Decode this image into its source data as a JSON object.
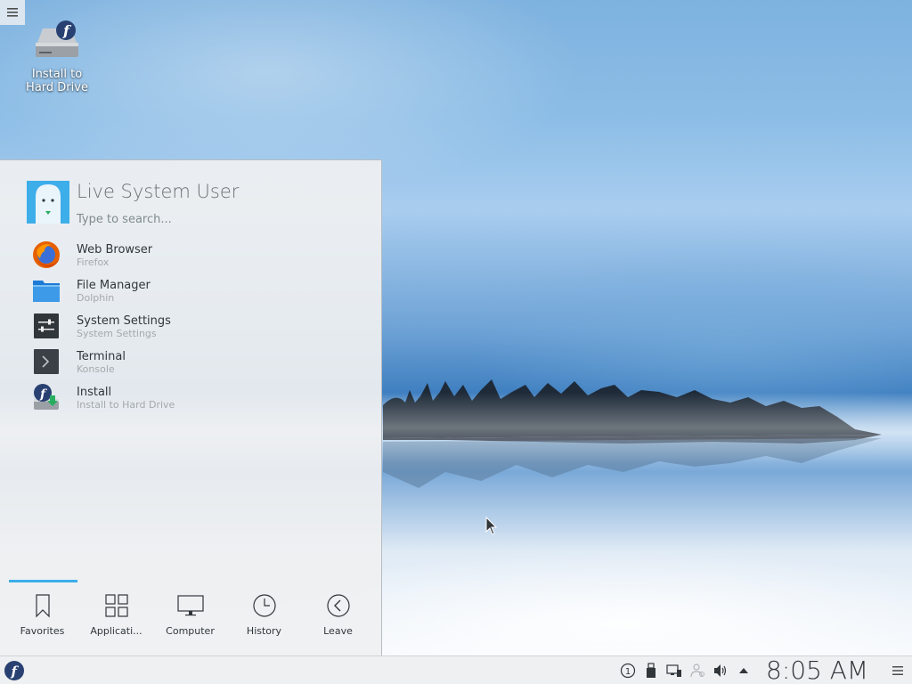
{
  "desktop": {
    "icons": [
      {
        "label": "Install to\nHard Drive",
        "icon": "fedora-install-drive-icon"
      }
    ],
    "toolbox_icon": "hamburger-menu-icon"
  },
  "launcher": {
    "user_name": "Live System User",
    "search_placeholder": "Type to search...",
    "favorites": [
      {
        "title": "Web Browser",
        "subtitle": "Firefox",
        "icon": "firefox-icon"
      },
      {
        "title": "File Manager",
        "subtitle": "Dolphin",
        "icon": "folder-icon"
      },
      {
        "title": "System Settings",
        "subtitle": "System Settings",
        "icon": "settings-icon"
      },
      {
        "title": "Terminal",
        "subtitle": "Konsole",
        "icon": "terminal-icon"
      },
      {
        "title": "Install",
        "subtitle": "Install to Hard Drive",
        "icon": "fedora-install-icon"
      }
    ],
    "tabs": [
      {
        "label": "Favorites",
        "icon": "bookmark-icon",
        "active": true
      },
      {
        "label": "Applicati...",
        "icon": "grid-icon",
        "active": false
      },
      {
        "label": "Computer",
        "icon": "monitor-icon",
        "active": false
      },
      {
        "label": "History",
        "icon": "clock-icon",
        "active": false
      },
      {
        "label": "Leave",
        "icon": "back-arrow-icon",
        "active": false
      }
    ],
    "accent_color": "#3daee9"
  },
  "panel": {
    "launcher_icon": "fedora-logo-icon",
    "tray": [
      {
        "name": "notifications-icon",
        "text": "1"
      },
      {
        "name": "usb-device-icon"
      },
      {
        "name": "network-icon"
      },
      {
        "name": "user-switch-icon"
      },
      {
        "name": "volume-icon"
      },
      {
        "name": "expand-tray-icon"
      }
    ],
    "clock": "8:05 AM",
    "menu_icon": "panel-menu-icon"
  }
}
